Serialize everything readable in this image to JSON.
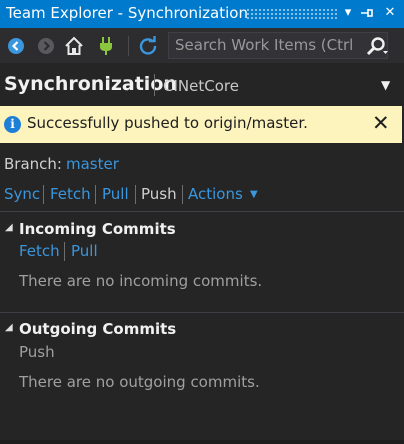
{
  "window": {
    "title": "Team Explorer - Synchronization",
    "buttons": {
      "dropdown": "▾",
      "pin": "⊣",
      "close": "✕"
    }
  },
  "toolbar": {
    "search_placeholder": "Search Work Items (Ctrl+",
    "icons": [
      "back-arrow-icon",
      "forward-arrow-icon",
      "home-icon",
      "plug-icon",
      "refresh-icon",
      "search-icon"
    ]
  },
  "header": {
    "title": "Synchronization",
    "repository": "CINetCore",
    "menu_glyph": "▼"
  },
  "notification": {
    "message": "Successfully pushed to origin/master.",
    "icon_glyph": "i",
    "close_glyph": "✕"
  },
  "branch": {
    "label": "Branch:",
    "value": "master"
  },
  "actions": {
    "sync": "Sync",
    "fetch": "Fetch",
    "pull": "Pull",
    "push": "Push",
    "more": "Actions",
    "more_glyph": "▼"
  },
  "incoming": {
    "toggle_glyph": "◢",
    "title": "Incoming Commits",
    "fetch": "Fetch",
    "pull": "Pull",
    "empty_message": "There are no incoming commits."
  },
  "outgoing": {
    "toggle_glyph": "◢",
    "title": "Outgoing Commits",
    "push": "Push",
    "empty_message": "There are no outgoing commits."
  },
  "colors": {
    "title_bar": "#007acc",
    "background": "#252526",
    "link": "#3a96dd",
    "info_bar": "#fcf3bd"
  }
}
